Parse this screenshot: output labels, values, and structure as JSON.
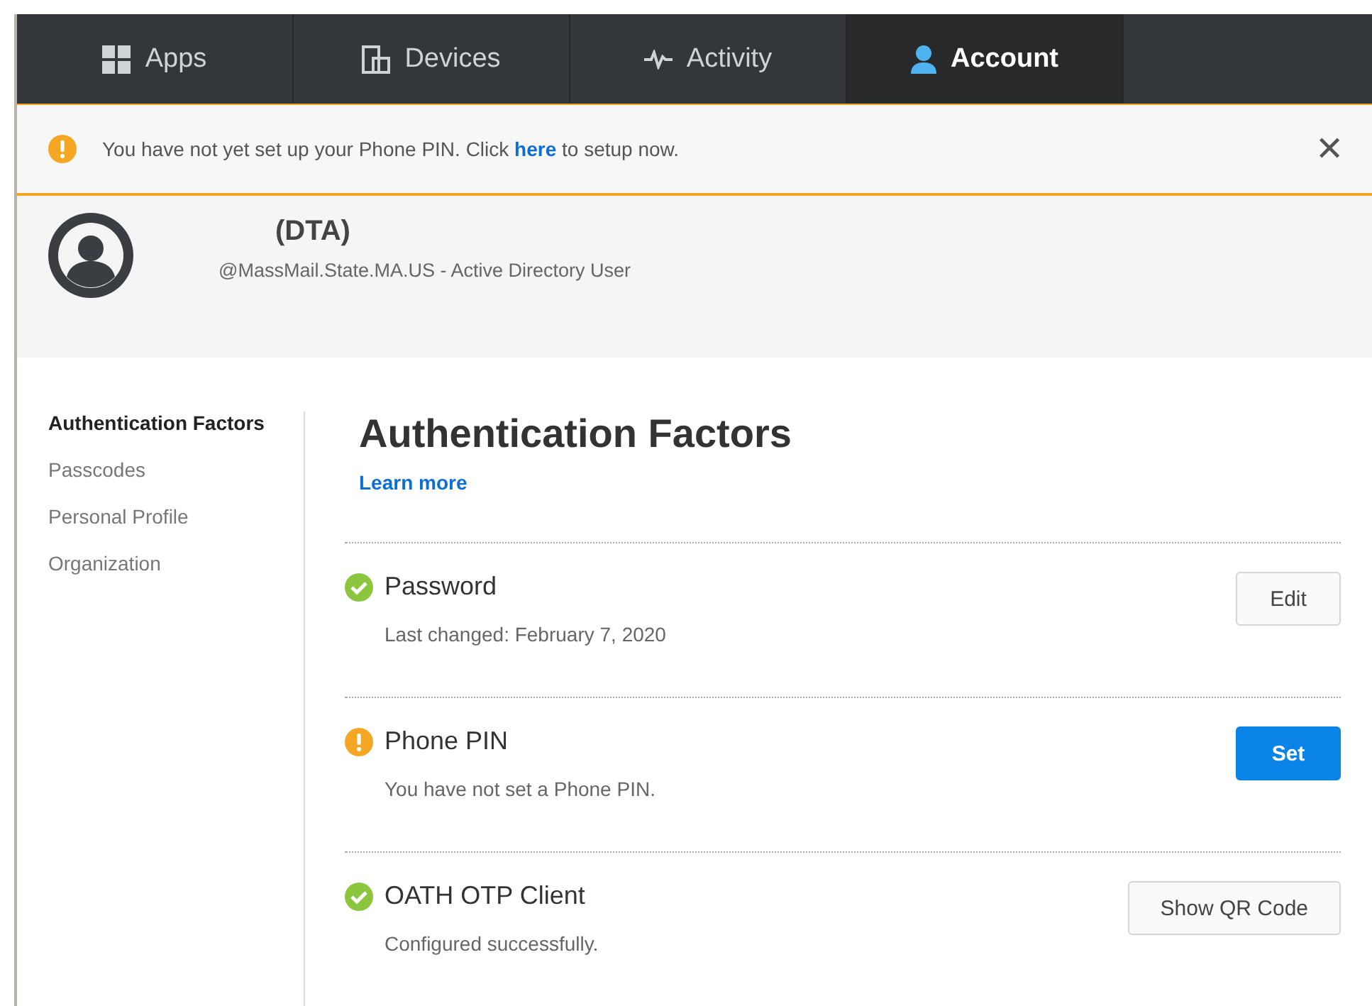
{
  "tabs": [
    {
      "label": "Apps",
      "kind": "apps",
      "selected": false
    },
    {
      "label": "Devices",
      "kind": "devices",
      "selected": false
    },
    {
      "label": "Activity",
      "kind": "activity",
      "selected": false
    },
    {
      "label": "Account",
      "kind": "account",
      "selected": true
    }
  ],
  "banner": {
    "message": "You have not yet set up your Phone PIN. Click **here** to setup now.",
    "close": "✕"
  },
  "profile": {
    "name": "(DTA)",
    "detail": "@MassMail.State.MA.US - Active Directory User"
  },
  "sidebar": {
    "items": [
      {
        "label": "Authentication Factors",
        "selected": true
      },
      {
        "label": "Passcodes",
        "selected": false
      },
      {
        "label": "Personal Profile",
        "selected": false
      },
      {
        "label": "Organization",
        "selected": false
      }
    ]
  },
  "main": {
    "title": "Authentication Factors",
    "link": "Learn more",
    "factors": [
      {
        "name": "Password",
        "kind": "ok",
        "detail": "Last changed: February 7, 2020",
        "button": {
          "label": "Edit",
          "kind": "default"
        }
      },
      {
        "name": "Phone PIN",
        "kind": "warning",
        "detail": "You have not set a Phone PIN.",
        "button": {
          "label": "Set",
          "kind": "primary"
        }
      },
      {
        "name": "OATH OTP Client",
        "kind": "ok",
        "detail": "Configured successfully.",
        "button": {
          "label": "Show QR Code",
          "kind": "default"
        }
      }
    ]
  }
}
